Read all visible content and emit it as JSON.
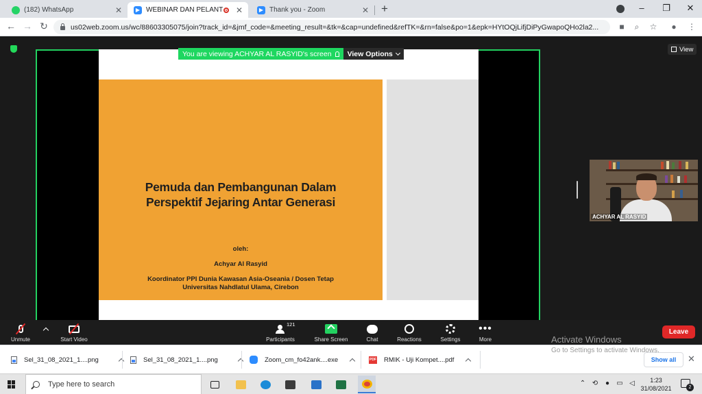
{
  "browser": {
    "tabs": [
      {
        "title": "(182) WhatsApp",
        "icon": "whatsapp-icon"
      },
      {
        "title": "WEBINAR DAN PELANTIKAN",
        "icon": "zoom-icon",
        "recording": true
      },
      {
        "title": "Thank you - Zoom",
        "icon": "zoom-icon"
      }
    ],
    "url": "us02web.zoom.us/wc/88603305075/join?track_id=&jmf_code=&meeting_result=&tk=&cap=undefined&refTK=&rn=false&po=1&epk=HYtOQjLifjDiPyGwapoQHo2la2..."
  },
  "meeting": {
    "view_button": "View",
    "viewing_banner": "You are viewing ACHYAR AL RASYID's screen",
    "view_options": "View Options",
    "slide": {
      "title": "Pemuda dan Pembangunan Dalam\nPerspektif Jejaring Antar Generasi",
      "oleh": "oleh:",
      "author": "Achyar Al Rasyid",
      "affiliation": "Koordinator PPI Dunia Kawasan Asia-Oseania / Dosen Tetap\nUniversitas Nahdlatul Ulama, Cirebon"
    },
    "participant_video_name": "ACHYAR AL RASYID"
  },
  "controls": {
    "unmute": "Unmute",
    "start_video": "Start Video",
    "participants": "Participants",
    "participant_count": "121",
    "share_screen": "Share Screen",
    "chat": "Chat",
    "reactions": "Reactions",
    "settings": "Settings",
    "more": "More",
    "leave": "Leave"
  },
  "watermark": {
    "line1": "Activate Windows",
    "line2": "Go to Settings to activate Windows."
  },
  "downloads": {
    "items": [
      {
        "name": "Sel_31_08_2021_1....png",
        "type": "image"
      },
      {
        "name": "Sel_31_08_2021_1....png",
        "type": "image"
      },
      {
        "name": "Zoom_cm_fo42ank....exe",
        "type": "zoom"
      },
      {
        "name": "RMIK - Uji Kompet....pdf",
        "type": "pdf"
      }
    ],
    "show_all": "Show all"
  },
  "taskbar": {
    "search_placeholder": "Type here to search",
    "time": "1:23",
    "date": "31/08/2021",
    "notification_count": "2"
  },
  "colors": {
    "zoom_green": "#23d160",
    "leave_red": "#e02828",
    "slide_orange": "#f0a233"
  }
}
